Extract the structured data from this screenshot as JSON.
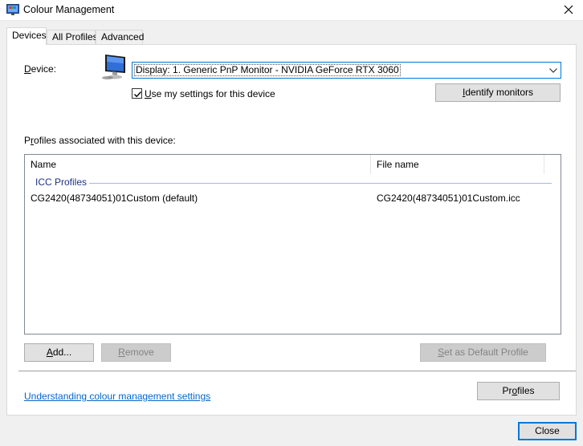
{
  "window": {
    "title": "Colour Management",
    "app_icon": "colour-management-icon",
    "close_icon": "close-icon"
  },
  "tabs": [
    {
      "label": "Devices",
      "active": true
    },
    {
      "label": "All Profiles",
      "active": false
    },
    {
      "label": "Advanced",
      "active": false
    }
  ],
  "device": {
    "label_mnemonic": "D",
    "label_rest": "evice:",
    "icon": "monitor-icon",
    "selected": "Display: 1. Generic PnP Monitor - NVIDIA GeForce RTX 3060"
  },
  "use_settings": {
    "checked": true,
    "label_mnemonic": "U",
    "label_rest": "se my settings for this device"
  },
  "identify_button": {
    "mnemonic": "I",
    "rest": "dentify monitors"
  },
  "profiles_label": {
    "mnemonic": "r",
    "pre": "P",
    "post": "ofiles associated with this device:"
  },
  "list": {
    "columns": [
      "Name",
      "File name"
    ],
    "group": "ICC Profiles",
    "rows": [
      {
        "name": "CG2420(48734051)01Custom (default)",
        "file": "CG2420(48734051)01Custom.icc"
      }
    ]
  },
  "buttons": {
    "add": {
      "mnemonic": "A",
      "rest": "dd...",
      "enabled": true
    },
    "remove": {
      "mnemonic": "R",
      "rest": "emove",
      "enabled": false
    },
    "set_default": {
      "mnemonic": "S",
      "rest": "et as Default Profile",
      "enabled": false
    },
    "profiles": {
      "pre": "Pr",
      "mnemonic": "o",
      "post": "files"
    },
    "close": {
      "label": "Close"
    }
  },
  "link": {
    "label": "Understanding colour management settings"
  },
  "colors": {
    "accent": "#0078d7",
    "link": "#0066cc",
    "group": "#1e3287"
  }
}
